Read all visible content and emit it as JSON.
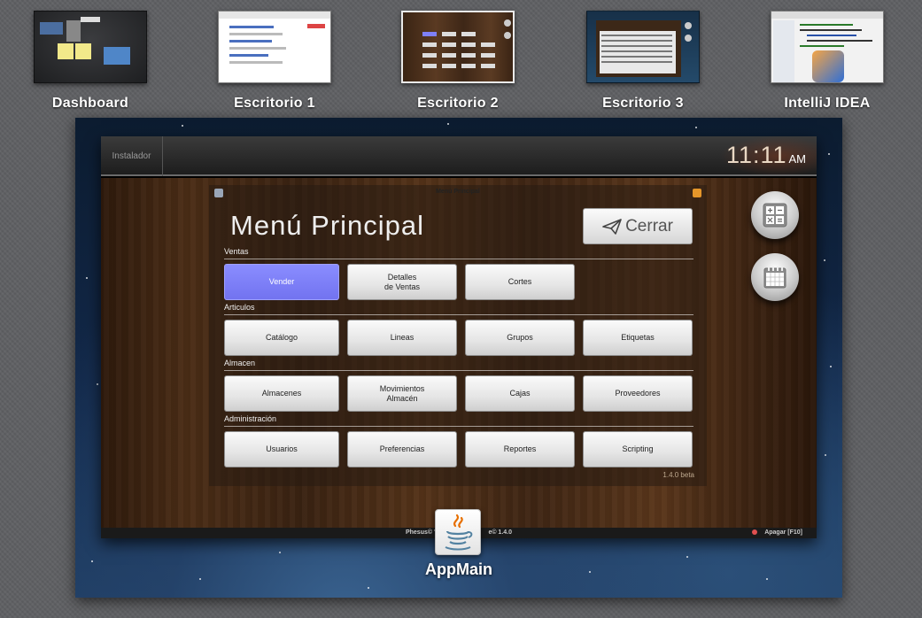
{
  "spaces": [
    {
      "label": "Dashboard"
    },
    {
      "label": "Escritorio 1"
    },
    {
      "label": "Escritorio 2",
      "active": true
    },
    {
      "label": "Escritorio 3"
    },
    {
      "label": "IntelliJ IDEA"
    }
  ],
  "app_window": {
    "tab": "Instalador",
    "clock": {
      "time": "11:11",
      "ampm": "AM"
    },
    "panel_title": "Menú Principal",
    "title": "Menú Principal",
    "close_label": "Cerrar",
    "sections": [
      {
        "label": "Ventas",
        "buttons": [
          "Vender",
          "Detalles\nde Ventas",
          "Cortes"
        ]
      },
      {
        "label": "Articulos",
        "buttons": [
          "Catálogo",
          "Lineas",
          "Grupos",
          "Etiquetas"
        ]
      },
      {
        "label": "Almacen",
        "buttons": [
          "Almacenes",
          "Movimientos\nAlmacén",
          "Cajas",
          "Proveedores"
        ]
      },
      {
        "label": "Administración",
        "buttons": [
          "Usuarios",
          "Preferencias",
          "Reportes",
          "Scripting"
        ]
      }
    ],
    "selected_button": "Vender",
    "version": "1.4.0 beta",
    "status_left": "Phesus© '0",
    "status_right": "e© 1.4.0",
    "shutdown": "Apagar [F10]"
  },
  "icons": {
    "close": "paper-plane-icon",
    "calculator": "calculator-icon",
    "calendar": "calendar-icon",
    "app": "java-icon"
  },
  "dock_app": {
    "label": "AppMain"
  },
  "colors": {
    "selected_button": "#7e80f8",
    "shutdown_dot": "#e05050"
  }
}
